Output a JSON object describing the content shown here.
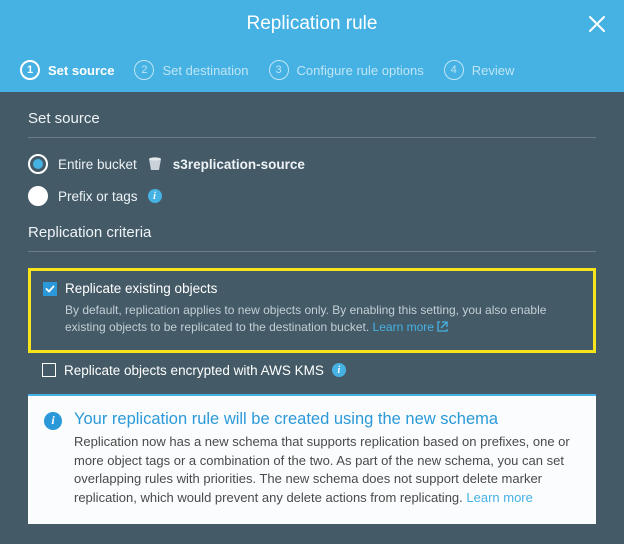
{
  "header": {
    "title": "Replication rule"
  },
  "steps": [
    {
      "num": "1",
      "label": "Set source",
      "active": true
    },
    {
      "num": "2",
      "label": "Set destination",
      "active": false
    },
    {
      "num": "3",
      "label": "Configure rule options",
      "active": false
    },
    {
      "num": "4",
      "label": "Review",
      "active": false
    }
  ],
  "source": {
    "title": "Set source",
    "entire_label": "Entire bucket",
    "bucket_name": "s3replication-source",
    "prefix_label": "Prefix or tags"
  },
  "criteria": {
    "title": "Replication criteria",
    "replicate_existing_label": "Replicate existing objects",
    "replicate_existing_help": "By default, replication applies to new objects only. By enabling this setting, you also enable existing objects to be replicated to the destination bucket.",
    "learn_more": "Learn more",
    "replicate_kms_label": "Replicate objects encrypted with AWS KMS"
  },
  "notice": {
    "title": "Your replication rule will be created using the new schema",
    "body": "Replication now has a new schema that supports replication based on prefixes, one or more object tags or a combination of the two. As part of the new schema, you can set overlapping rules with priorities. The new schema does not support delete marker replication, which would prevent any delete actions from replicating.",
    "learn_more": "Learn more"
  }
}
